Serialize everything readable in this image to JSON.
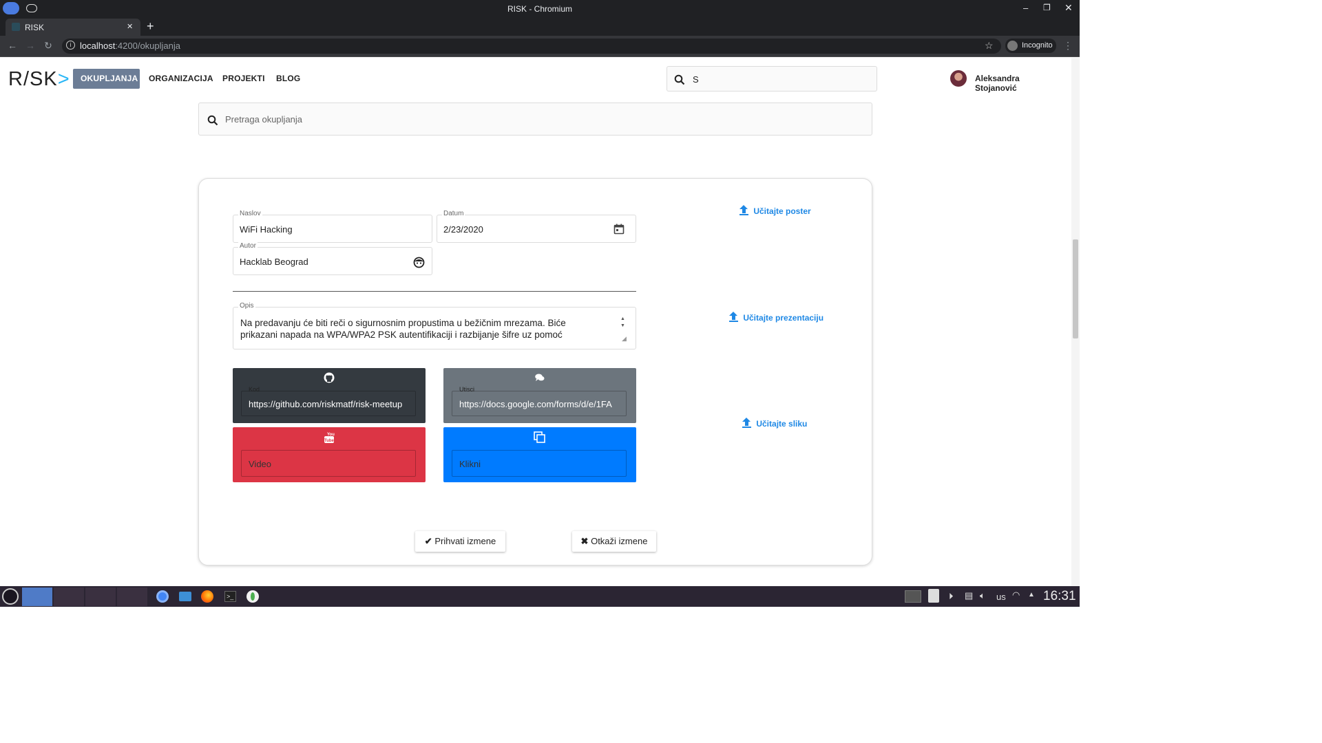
{
  "window": {
    "title": "RISK - Chromium"
  },
  "tab": {
    "label": "RISK",
    "new_tab": "+"
  },
  "address": {
    "host": "localhost",
    "path": ":4200/okupljanja",
    "incognito": "Incognito"
  },
  "app": {
    "logo": "R/SK",
    "nav": [
      "OKUPLJANJA",
      "ORGANIZACIJA",
      "PROJEKTI",
      "BLOG"
    ],
    "search_value": "S",
    "user_name": "Aleksandra Stojanović"
  },
  "meetups_search": {
    "placeholder": "Pretraga okupljanja"
  },
  "form": {
    "title_label": "Naslov",
    "title_value": "WiFi Hacking",
    "date_label": "Datum",
    "date_value": "2/23/2020",
    "author_label": "Autor",
    "author_value": "Hacklab Beograd",
    "desc_label": "Opis",
    "desc_value": "Na predavanju će biti reči o sigurnosnim propustima u bežičnim mrezama. Biće prikazani napada na WPA/WPA2 PSK autentifikaciji i razbijanje šifre uz pomoć",
    "code_label": "Kod",
    "code_value": "https://github.com/riskmatf/risk-meetup",
    "impressions_label": "Utisci",
    "impressions_value": "https://docs.google.com/forms/d/e/1FA",
    "video_placeholder": "Video",
    "click_placeholder": "Klikni",
    "upload_poster": "Učitajte poster",
    "upload_presentation": "Učitajte prezentaciju",
    "upload_image": "Učitajte sliku",
    "accept": "Prihvati izmene",
    "cancel": "Otkaži izmene"
  },
  "taskbar": {
    "keyboard": "us",
    "clock": "16:31"
  },
  "colors": {
    "code": "#343a40",
    "impressions": "#6c757d",
    "video": "#dc3545",
    "click": "#007bff",
    "accent": "#1e88e5",
    "nav_active": "#6c7d96"
  }
}
